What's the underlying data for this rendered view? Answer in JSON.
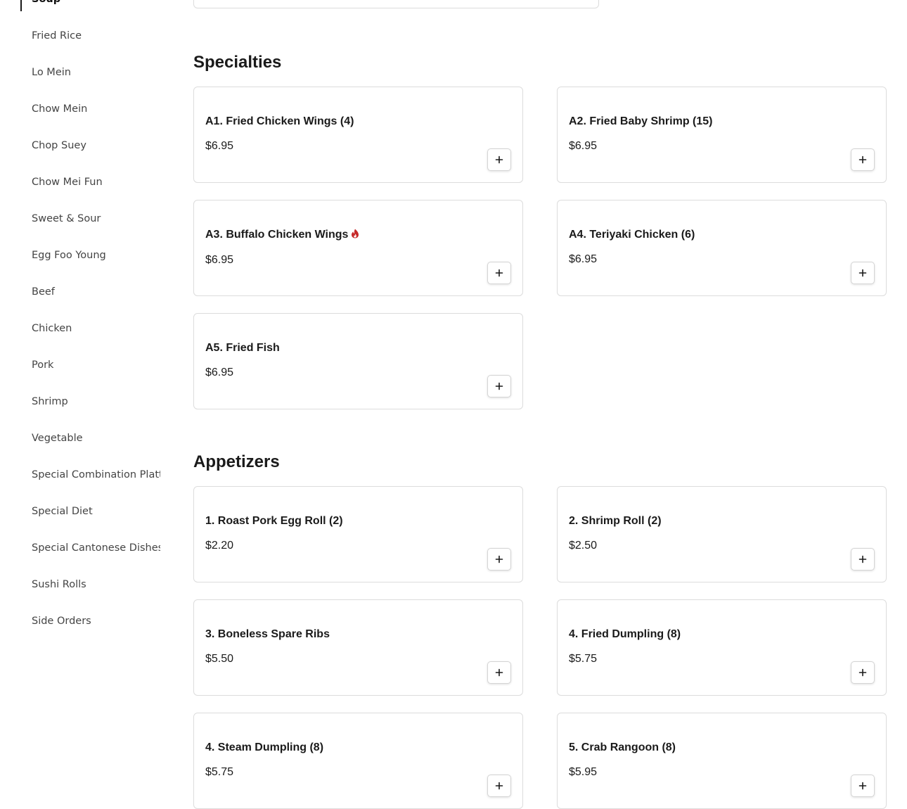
{
  "sidebar": {
    "items": [
      {
        "label": "Soup",
        "active": true
      },
      {
        "label": "Fried Rice"
      },
      {
        "label": "Lo Mein"
      },
      {
        "label": "Chow Mein"
      },
      {
        "label": "Chop Suey"
      },
      {
        "label": "Chow Mei Fun"
      },
      {
        "label": "Sweet & Sour"
      },
      {
        "label": "Egg Foo Young"
      },
      {
        "label": "Beef"
      },
      {
        "label": "Chicken"
      },
      {
        "label": "Pork"
      },
      {
        "label": "Shrimp"
      },
      {
        "label": "Vegetable"
      },
      {
        "label": "Special Combination Platters"
      },
      {
        "label": "Special Diet"
      },
      {
        "label": "Special Cantonese Dishes"
      },
      {
        "label": "Sushi Rolls"
      },
      {
        "label": "Side Orders"
      }
    ]
  },
  "sections": [
    {
      "title": "Specialties",
      "items": [
        {
          "name": "A1. Fried Chicken Wings (4)",
          "price": "$6.95"
        },
        {
          "name": "A2. Fried Baby Shrimp (15)",
          "price": "$6.95"
        },
        {
          "name": "A3. Buffalo Chicken Wings",
          "price": "$6.95",
          "spicy": true
        },
        {
          "name": "A4. Teriyaki Chicken (6)",
          "price": "$6.95"
        },
        {
          "name": "A5. Fried Fish",
          "price": "$6.95"
        }
      ]
    },
    {
      "title": "Appetizers",
      "items": [
        {
          "name": "1. Roast Pork Egg Roll (2)",
          "price": "$2.20"
        },
        {
          "name": "2. Shrimp Roll (2)",
          "price": "$2.50"
        },
        {
          "name": "3. Boneless Spare Ribs",
          "price": "$5.50"
        },
        {
          "name": "4. Fried Dumpling (8)",
          "price": "$5.75"
        },
        {
          "name": "4. Steam Dumpling (8)",
          "price": "$5.75"
        },
        {
          "name": "5. Crab Rangoon (8)",
          "price": "$5.95"
        }
      ]
    }
  ],
  "icons": {
    "add": "plus-icon",
    "spicy": "chili-pepper-icon"
  },
  "colors": {
    "spicy": "#c62828",
    "text": "#1a1a1a",
    "border": "#dcdcdc"
  }
}
